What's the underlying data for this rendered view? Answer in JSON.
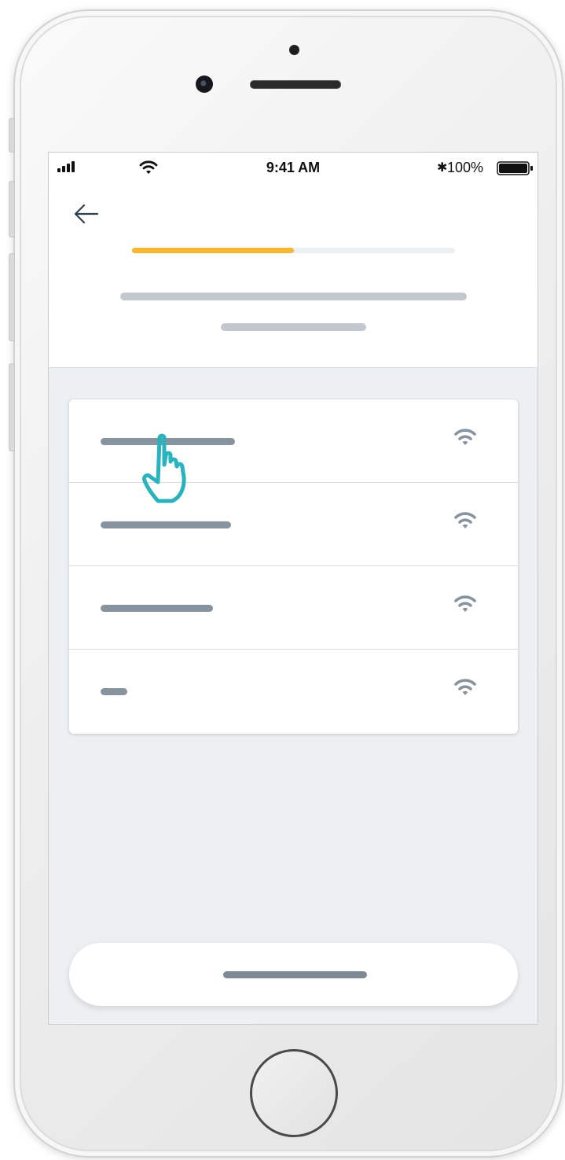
{
  "status_bar": {
    "time": "9:41 AM",
    "battery_percent": "100%",
    "bluetooth_glyph": "✱",
    "battery_level": 1.0
  },
  "header": {
    "back_icon": "arrow-left-icon",
    "progress": 0.5,
    "progress_color": "#f7b731"
  },
  "networks": [
    {
      "ssid_placeholder_width": 0.3,
      "signal_icon": "wifi-signal-icon"
    },
    {
      "ssid_placeholder_width": 0.29,
      "signal_icon": "wifi-signal-icon"
    },
    {
      "ssid_placeholder_width": 0.25,
      "signal_icon": "wifi-signal-icon"
    },
    {
      "ssid_placeholder_width": 0.06,
      "signal_icon": "wifi-signal-icon"
    }
  ],
  "gesture_hint": {
    "icon": "tap-hand-icon",
    "color": "#29b3bd"
  },
  "colors": {
    "placeholder_text": "#8794a0",
    "header_placeholder": "#c3c8ce",
    "background": "#edf0f2"
  }
}
